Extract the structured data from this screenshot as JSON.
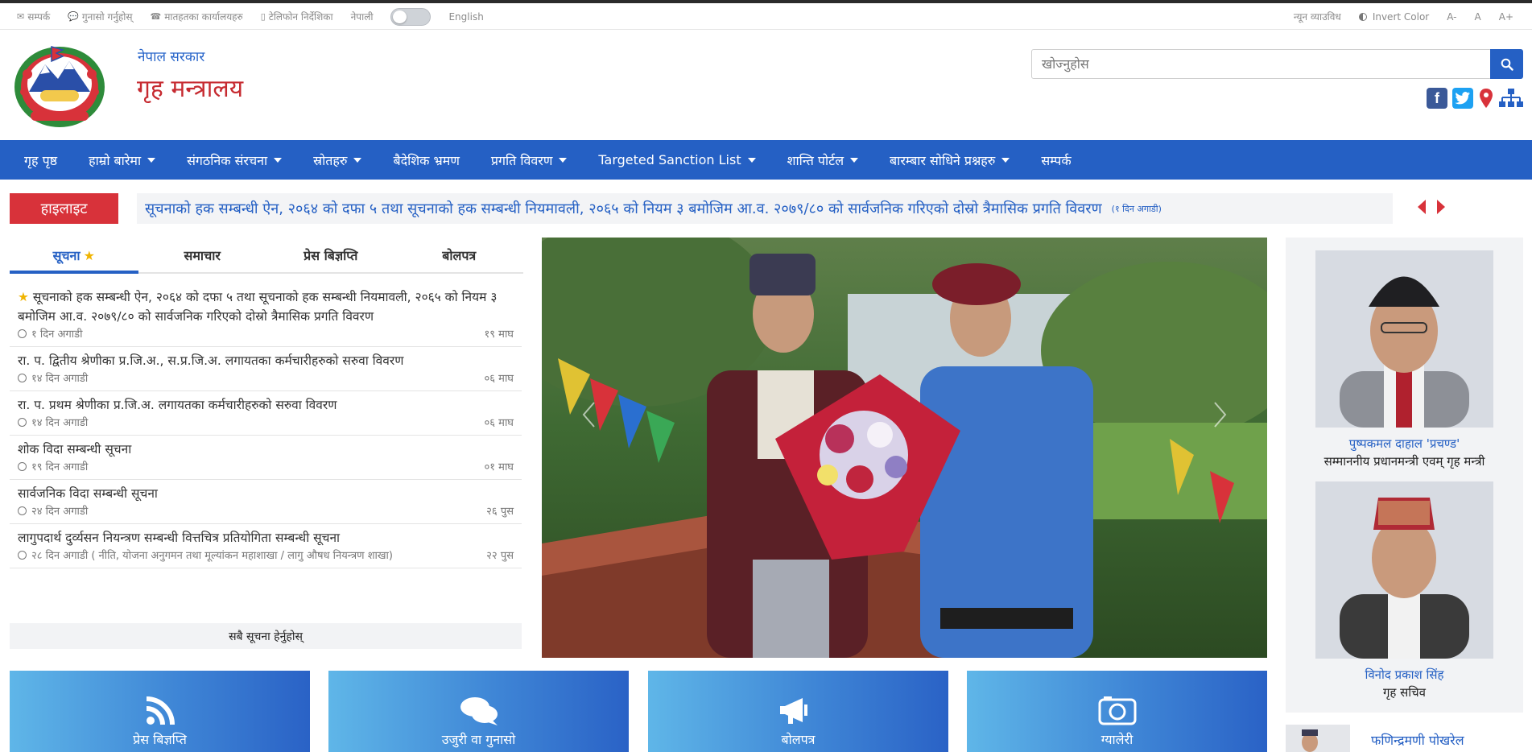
{
  "util": {
    "contact": "सम्पर्क",
    "grievance": "गुनासो गर्नुहोस्",
    "offices": "मातहतका कार्यालयहरु",
    "directory": "टेलिफोन निर्देशिका",
    "lang_np": "नेपाली",
    "lang_en": "English",
    "min_view": "न्यून व्याउविध",
    "invert": "Invert Color",
    "font_minus": "A-",
    "font_normal": "A",
    "font_plus": "A+"
  },
  "header": {
    "gov_name": "नेपाल सरकार",
    "ministry": "गृह मन्त्रालय",
    "search_placeholder": "खोज्नुहोस"
  },
  "nav": [
    {
      "label": "गृह पृष्ठ",
      "dropdown": false
    },
    {
      "label": "हाम्रो बारेमा",
      "dropdown": true
    },
    {
      "label": "संगठनिक संरचना",
      "dropdown": true
    },
    {
      "label": "स्रोतहरु",
      "dropdown": true
    },
    {
      "label": "बैदेशिक भ्रमण",
      "dropdown": false
    },
    {
      "label": "प्रगति विवरण",
      "dropdown": true
    },
    {
      "label": "Targeted Sanction List",
      "dropdown": true
    },
    {
      "label": "शान्ति पोर्टल",
      "dropdown": true
    },
    {
      "label": "बारम्बार सोधिने प्रश्नहरु",
      "dropdown": true
    },
    {
      "label": "सम्पर्क",
      "dropdown": false
    }
  ],
  "highlight": {
    "label": "हाइलाइट",
    "text": "सूचनाको हक सम्बन्धी ऐन, २०६४ को दफा ५ तथा सूचनाको हक सम्बन्धी नियमावली, २०६५ को नियम ३ बमोजिम आ.व. २०७९/८० को सार्वजनिक गरिएको दोस्रो त्रैमासिक प्रगति विवरण",
    "ago": "(१ दिन अगाडी)"
  },
  "tabs": [
    "सूचना",
    "समाचार",
    "प्रेस बिज्ञप्ति",
    "बोलपत्र"
  ],
  "notices": [
    {
      "title": "सूचनाको हक सम्बन्धी ऐन, २०६४ को दफा ५ तथा सूचनाको हक सम्बन्धी नियमावली, २०६५ को नियम ३ बमोजिम आ.व. २०७९/८० को सार्वजनिक गरिएको दोस्रो त्रैमासिक प्रगति विवरण",
      "ago": "१ दिन अगाडी",
      "date": "१९ माघ"
    },
    {
      "title": "रा. प. द्वितीय श्रेणीका प्र.जि.अ., स.प्र.जि.अ. लगायतका कर्मचारीहरुको सरुवा विवरण",
      "ago": "१४ दिन अगाडी",
      "date": "०६ माघ"
    },
    {
      "title": "रा. प. प्रथम श्रेणीका प्र.जि.अ. लगायतका कर्मचारीहरुको सरुवा विवरण",
      "ago": "१४ दिन अगाडी",
      "date": "०६ माघ"
    },
    {
      "title": "शोक विदा सम्बन्धी सूचना",
      "ago": "१९ दिन अगाडी",
      "date": "०१ माघ"
    },
    {
      "title": "सार्वजनिक विदा सम्बन्धी सूचना",
      "ago": "२४ दिन अगाडी",
      "date": "२६ पुस"
    },
    {
      "title": "लागुपदार्थ दुर्व्यसन नियन्त्रण सम्बन्धी वित्तचित्र प्रतियोगिता सम्बन्धी सूचना",
      "ago": "२८ दिन अगाडी ( नीति, योजना अनुगमन तथा मूल्यांकन महाशाखा / लागु औषध नियन्त्रण शाखा)",
      "date": "२२ पुस"
    }
  ],
  "see_all": "सबै सूचना हेर्नुहोस्",
  "officials": [
    {
      "name": "पुष्पकमल दाहाल 'प्रचण्ड'",
      "role": "सम्माननीय प्रधानमन्त्री एवम् गृह मन्त्री"
    },
    {
      "name": "विनोद प्रकाश सिंह",
      "role": "गृह सचिव"
    }
  ],
  "third_official": "फणिन्द्रमणी पोखरेल",
  "tiles": [
    "प्रेस बिज्ञप्ति",
    "उजुरी वा गुनासो",
    "बोलपत्र",
    "ग्यालेरी"
  ],
  "colors": {
    "primary": "#2560c4",
    "accent_red": "#d8323a",
    "title_red": "#c62a30"
  }
}
